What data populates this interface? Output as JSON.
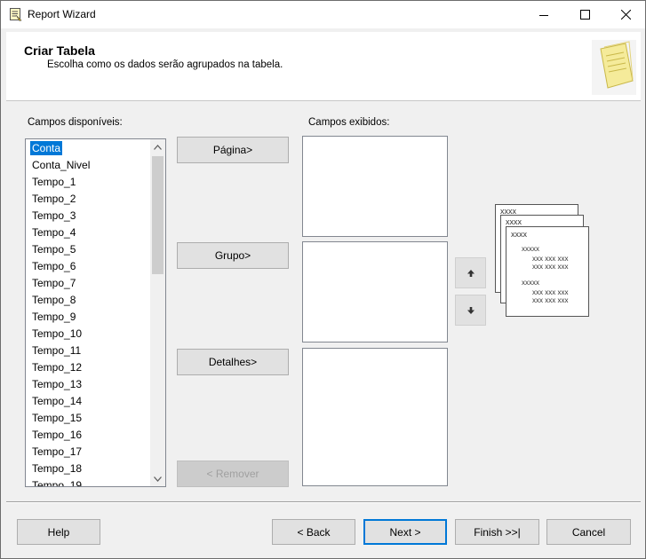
{
  "window": {
    "title": "Report Wizard"
  },
  "header": {
    "title": "Criar Tabela",
    "subtitle": "Escolha como os dados serão agrupados na tabela."
  },
  "available": {
    "label": "Campos disponíveis:",
    "items": [
      "Conta",
      "Conta_Nivel",
      "Tempo_1",
      "Tempo_2",
      "Tempo_3",
      "Tempo_4",
      "Tempo_5",
      "Tempo_6",
      "Tempo_7",
      "Tempo_8",
      "Tempo_9",
      "Tempo_10",
      "Tempo_11",
      "Tempo_12",
      "Tempo_13",
      "Tempo_14",
      "Tempo_15",
      "Tempo_16",
      "Tempo_17",
      "Tempo_18",
      "Tempo_19"
    ],
    "selected": "Conta"
  },
  "displayed": {
    "label": "Campos exibidos:"
  },
  "move_buttons": {
    "page": "Página>",
    "group": "Grupo>",
    "details": "Detalhes>",
    "remove": "< Remover"
  },
  "preview": {
    "header_text": "xxxx",
    "group_text": "xxxxx",
    "detail_text": "xxx xxx xxx"
  },
  "footer": {
    "help": "Help",
    "back": "< Back",
    "next": "Next >",
    "finish": "Finish >>|",
    "cancel": "Cancel"
  },
  "colors": {
    "selection": "#0078d7",
    "primary_border": "#0078d7"
  }
}
